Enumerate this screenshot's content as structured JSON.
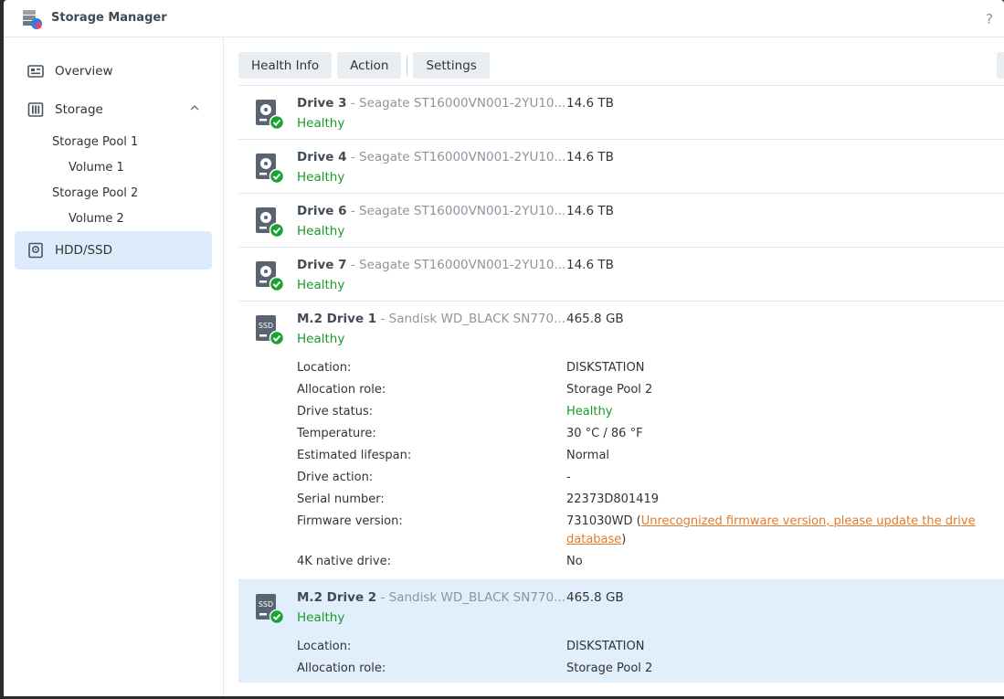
{
  "window": {
    "title": "Storage Manager",
    "help": "?"
  },
  "sidebar": {
    "overview": "Overview",
    "storage": "Storage",
    "pool1": "Storage Pool 1",
    "vol1": "Volume 1",
    "pool2": "Storage Pool 2",
    "vol2": "Volume 2",
    "hdd": "HDD/SSD"
  },
  "toolbar": {
    "health": "Health Info",
    "action": "Action",
    "settings": "Settings"
  },
  "drives": [
    {
      "name": "Drive 3",
      "model": " - Seagate ST16000VN001-2YU10...",
      "size": "14.6 TB",
      "status": "Healthy",
      "kind": "hdd"
    },
    {
      "name": "Drive 4",
      "model": " - Seagate ST16000VN001-2YU10...",
      "size": "14.6 TB",
      "status": "Healthy",
      "kind": "hdd"
    },
    {
      "name": "Drive 6",
      "model": " - Seagate ST16000VN001-2YU10...",
      "size": "14.6 TB",
      "status": "Healthy",
      "kind": "hdd"
    },
    {
      "name": "Drive 7",
      "model": " - Seagate ST16000VN001-2YU10...",
      "size": "14.6 TB",
      "status": "Healthy",
      "kind": "hdd"
    },
    {
      "name": "M.2 Drive 1",
      "model": " - Sandisk WD_BLACK SN770...",
      "size": "465.8 GB",
      "status": "Healthy",
      "kind": "ssd"
    },
    {
      "name": "M.2 Drive 2",
      "model": " - Sandisk WD_BLACK SN770...",
      "size": "465.8 GB",
      "status": "Healthy",
      "kind": "ssd"
    }
  ],
  "details1": {
    "location_l": "Location:",
    "location_v": "DISKSTATION",
    "alloc_l": "Allocation role:",
    "alloc_v": "Storage Pool 2",
    "status_l": "Drive status:",
    "status_v": "Healthy",
    "temp_l": "Temperature:",
    "temp_v": "30 °C / 86 °F",
    "life_l": "Estimated lifespan:",
    "life_v": "Normal",
    "action_l": "Drive action:",
    "action_v": "-",
    "serial_l": "Serial number:",
    "serial_v": "22373D801419",
    "fw_l": "Firmware version:",
    "fw_v": "731030WD (",
    "fw_link1": "Unrecognized firmware version, please update the drive",
    "fw_link2": "database",
    "fw_close": ")",
    "native_l": "4K native drive:",
    "native_v": "No"
  },
  "details2": {
    "location_l": "Location:",
    "location_v": "DISKSTATION",
    "alloc_l": "Allocation role:",
    "alloc_v": "Storage Pool 2"
  },
  "ssd_badge": "SSD",
  "colors": {
    "healthy": "#1a9a2a",
    "link": "#e27a2c",
    "selected": "#e1eefb"
  }
}
